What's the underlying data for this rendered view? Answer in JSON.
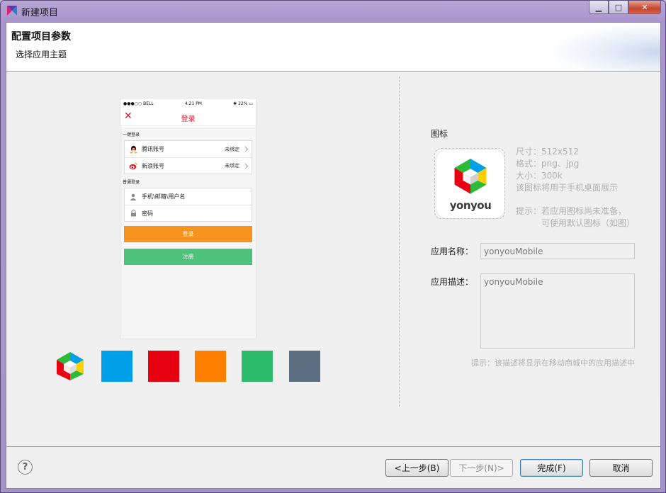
{
  "window": {
    "title": "新建项目"
  },
  "header": {
    "title": "配置项目参数",
    "subtitle": "选择应用主题"
  },
  "phone_preview": {
    "status": {
      "carrier": "●●●○○ BELL",
      "time": "4:21 PM",
      "battery": "22%"
    },
    "nav_title": "登录",
    "quick_login_label": "一键登录",
    "quick_login_rows": [
      {
        "label": "腾讯账号",
        "value": "未绑定",
        "icon": "qq-icon"
      },
      {
        "label": "新浪账号",
        "value": "未绑定",
        "icon": "weibo-icon"
      }
    ],
    "normal_login_label": "普通登录",
    "username_placeholder": "手机\\邮箱\\用户名",
    "password_placeholder": "密码",
    "login_button": "登录",
    "register_button": "注册",
    "login_color": "#f7931e",
    "register_color": "#4cc27a"
  },
  "themes": {
    "colors": [
      "#00a0e9",
      "#e60012",
      "#ff7f00",
      "#2dba6a",
      "#5d6e82"
    ]
  },
  "form": {
    "icon_label": "图标",
    "icon_brand": "yonyou",
    "icon_info": [
      "尺寸：512x512",
      "格式：png、jpg",
      "大小：300k",
      "该图标将用于手机桌面展示"
    ],
    "icon_tip_line1": "提示：若应用图标尚未准备，",
    "icon_tip_line2": "可使用默认图标（如图）",
    "app_name_label": "应用名称：",
    "app_name_value": "yonyouMobile",
    "app_desc_label": "应用描述：",
    "app_desc_value": "yonyouMobile",
    "desc_tip": "提示：该描述将显示在移动商城中的应用描述中"
  },
  "footer": {
    "help": "?",
    "back": "<上一步(B)",
    "next": "下一步(N)>",
    "finish": "完成(F)",
    "cancel": "取消"
  }
}
